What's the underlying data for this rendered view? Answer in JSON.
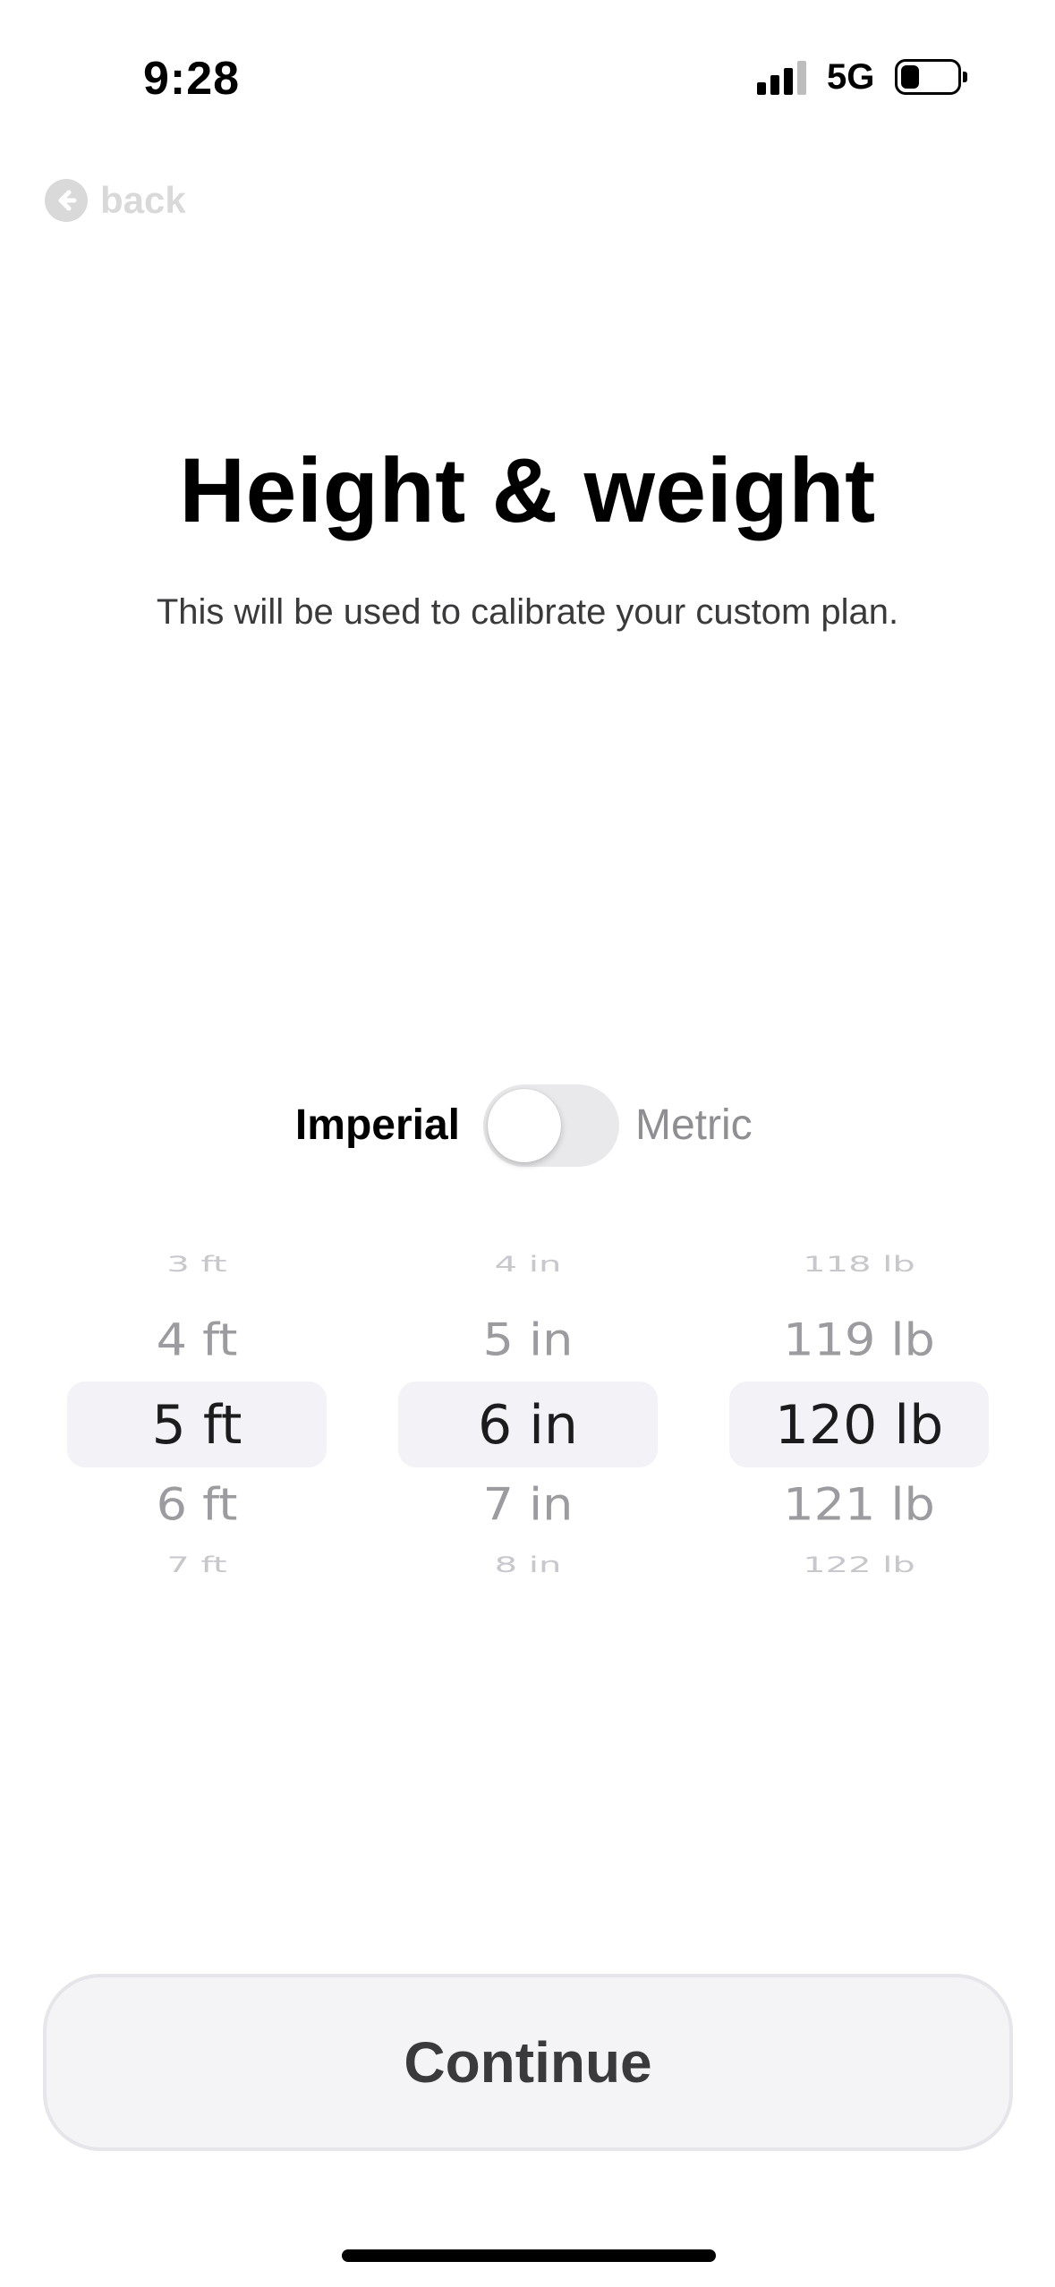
{
  "status_bar": {
    "time": "9:28",
    "network": "5G",
    "signal_icon": "cellular-signal-icon",
    "battery_icon": "battery-low-icon"
  },
  "nav": {
    "back_label": "back",
    "back_icon": "arrow-left-circle-icon"
  },
  "header": {
    "title": "Height & weight",
    "subtitle": "This will be used to calibrate your custom plan."
  },
  "unit_toggle": {
    "left_label": "Imperial",
    "right_label": "Metric",
    "selected": "Imperial"
  },
  "pickers": {
    "feet": {
      "items": [
        "3 ft",
        "4 ft",
        "5 ft",
        "6 ft",
        "7 ft"
      ],
      "selected": "5 ft"
    },
    "inches": {
      "items": [
        "4 in",
        "5 in",
        "6 in",
        "7 in",
        "8 in"
      ],
      "selected": "6 in"
    },
    "weight": {
      "items": [
        "118 lb",
        "119 lb",
        "120 lb",
        "121 lb",
        "122 lb"
      ],
      "selected": "120 lb"
    }
  },
  "footer": {
    "continue_label": "Continue"
  },
  "colors": {
    "primary_text": "#000000",
    "secondary_text": "#8e8e93",
    "button_background": "#f4f4f6",
    "picker_highlight": "#f2f2f7"
  }
}
